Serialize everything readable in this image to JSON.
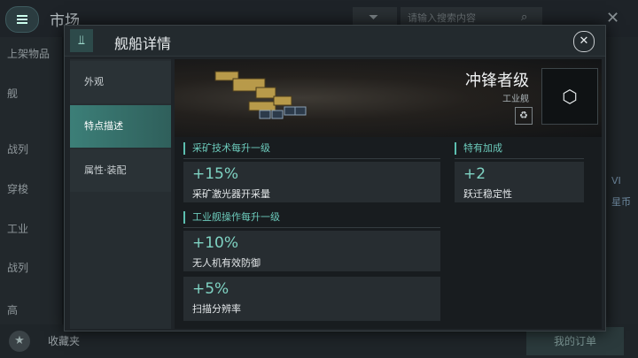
{
  "background": {
    "title": "市场",
    "search_placeholder": "请输入搜索内容",
    "left_rows": [
      "上架物品",
      "舰",
      "战列",
      "穿梭",
      "工业",
      "战列",
      "高"
    ],
    "right_tags": [
      "VI",
      "星币"
    ],
    "bottom": {
      "favorites": "收藏夹",
      "place_order": "我的订单"
    }
  },
  "modal": {
    "title": "舰船详情",
    "tabs": [
      {
        "label": "外观"
      },
      {
        "label": "特点描述"
      },
      {
        "label": "属性·装配"
      }
    ],
    "active_tab": "特点描述",
    "ship": {
      "name": "冲锋者级",
      "class": "工业舰"
    },
    "sections": [
      {
        "title": "采矿技术每升一级",
        "bonuses": [
          {
            "value": "+15%",
            "label": "采矿激光器开采量"
          }
        ]
      },
      {
        "title": "工业舰操作每升一级",
        "bonuses": [
          {
            "value": "+10%",
            "label": "无人机有效防御"
          },
          {
            "value": "+5%",
            "label": "扫描分辨率"
          }
        ]
      }
    ],
    "special": {
      "title": "特有加成",
      "bonuses": [
        {
          "value": "+2",
          "label": "跃迁稳定性"
        }
      ]
    }
  },
  "colors": {
    "accent": "#6ccabb",
    "active_tab": "#3c7f78"
  },
  "icons": {
    "menu": "menu-icon",
    "filter": "filter-icon",
    "search": "search-icon",
    "close": "close-icon",
    "ship_header": "ship-header-icon",
    "recycle": "recycle-icon",
    "ship_type": "ship-type-icon",
    "star": "star-icon"
  }
}
